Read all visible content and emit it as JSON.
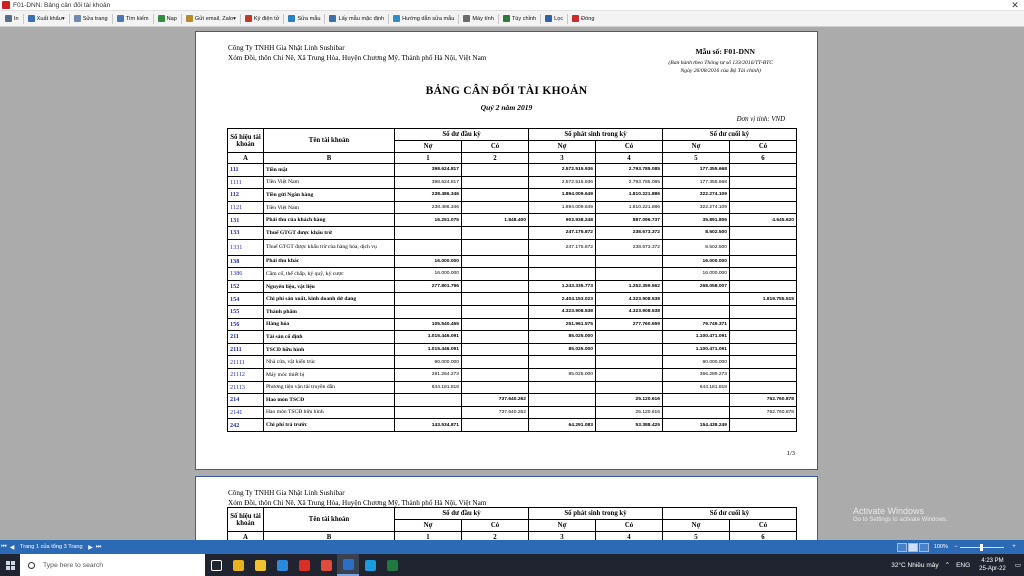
{
  "window": {
    "title": "F01-DNN: Bảng cân đối tài khoản",
    "close_glyph": "✕"
  },
  "toolbar": [
    {
      "name": "print",
      "label": "In",
      "color": "#5a6c8c"
    },
    {
      "name": "export",
      "label": "Xuất khẩu",
      "color": "#3a6fb3",
      "caret": true
    },
    {
      "name": "edit",
      "label": "Sửa trang",
      "color": "#6f8bb0"
    },
    {
      "name": "find",
      "label": "Tìm kiếm",
      "color": "#4a78b8"
    },
    {
      "name": "load",
      "label": "Nạp",
      "color": "#2f8f3c"
    },
    {
      "name": "email",
      "label": "Gửi email, Zalo",
      "color": "#b48a2a",
      "caret": true
    },
    {
      "name": "esign",
      "label": "Ký điện tử",
      "color": "#c0392b"
    },
    {
      "name": "edit-template",
      "label": "Sửa mẫu",
      "color": "#2a7fc4"
    },
    {
      "name": "default-template",
      "label": "Lấy mẫu mặc định",
      "color": "#3d6fa8"
    },
    {
      "name": "guide",
      "label": "Hướng dẫn sửa mẫu",
      "color": "#2b8fce"
    },
    {
      "name": "calculator",
      "label": "Máy tính",
      "color": "#6a6a6a"
    },
    {
      "name": "options",
      "label": "Tùy chỉnh",
      "color": "#2f7a3a"
    },
    {
      "name": "filter",
      "label": "Lọc",
      "color": "#2f62a8"
    },
    {
      "name": "close",
      "label": "Đóng",
      "color": "#cc2b2b"
    }
  ],
  "report": {
    "company_name": "Công Ty TNHH Gia Nhật Linh Sushibar",
    "company_address": "Xóm Đồi, thôn Chi Nê, Xã Trung Hòa, Huyện Chương Mỹ, Thành phố Hà Nội, Việt Nam",
    "form_no": "Mẫu số: F01-DNN",
    "form_note1": "(Ban hành theo Thông tư số 133/2016/TT-BTC",
    "form_note2": "Ngày 26/08/2016 của Bộ Tài chính)",
    "title": "BẢNG CÂN ĐỐI TÀI KHOẢN",
    "period": "Quý 2 năm 2019",
    "unit": "Đơn vị tính: VND",
    "page_number": "1/3",
    "headers": {
      "code": "Số hiệu tài khoản",
      "name": "Tên tài khoản",
      "opening": "Số dư đầu kỳ",
      "movement": "Số phát sinh trong kỳ",
      "closing": "Số dư cuối kỳ",
      "debit": "Nợ",
      "credit": "Có"
    },
    "index_row": [
      "A",
      "B",
      "1",
      "2",
      "3",
      "4",
      "5",
      "6"
    ],
    "rows": [
      {
        "code": "111",
        "name": "Tiền mặt",
        "bold": true,
        "v": [
          "398.624.817",
          "",
          "2.572.515.936",
          "2.793.785.085",
          "177.355.668",
          ""
        ]
      },
      {
        "code": "1111",
        "name": "Tiền Việt Nam",
        "v": [
          "398.624.817",
          "",
          "2.572.515.936",
          "2.793.785.085",
          "177.355.668",
          ""
        ]
      },
      {
        "code": "112",
        "name": "Tiền gửi Ngân hàng",
        "bold": true,
        "v": [
          "238.486.346",
          "",
          "1.894.009.649",
          "1.810.221.886",
          "322.274.109",
          ""
        ]
      },
      {
        "code": "1121",
        "name": "Tiền Việt Nam",
        "v": [
          "238.486.346",
          "",
          "1.894.009.649",
          "1.810.221.886",
          "322.274.109",
          ""
        ]
      },
      {
        "code": "131",
        "name": "Phải thu của khách hàng",
        "bold": true,
        "v": [
          "16.251.075",
          "1.848.400",
          "903.938.248",
          "887.096.737",
          "35.891.806",
          "4.645.620"
        ]
      },
      {
        "code": "133",
        "name": "Thuế GTGT được khấu trừ",
        "bold": true,
        "v": [
          "",
          "",
          "247.175.872",
          "238.673.372",
          "8.502.500",
          ""
        ]
      },
      {
        "code": "1331",
        "name": "Thuế GTGT được khấu trừ của hàng hóa, dịch vụ",
        "tall": true,
        "v": [
          "",
          "",
          "247.175.872",
          "238.673.372",
          "8.502.500",
          ""
        ]
      },
      {
        "code": "138",
        "name": "Phải thu khác",
        "bold": true,
        "v": [
          "16.000.000",
          "",
          "",
          "",
          "16.000.000",
          ""
        ]
      },
      {
        "code": "1386",
        "name": "Cầm cố, thế chấp, ký quỹ, ký cược",
        "v": [
          "16.000.000",
          "",
          "",
          "",
          "16.000.000",
          ""
        ]
      },
      {
        "code": "152",
        "name": "Nguyên liệu, vật liệu",
        "bold": true,
        "v": [
          "277.801.796",
          "",
          "1.243.335.773",
          "1.252.359.562",
          "268.058.007",
          ""
        ]
      },
      {
        "code": "154",
        "name": "Chi phí sản xuất, kinh doanh dở dang",
        "bold": true,
        "v": [
          "",
          "",
          "2.404.153.023",
          "4.323.908.538",
          "",
          "1.919.755.515"
        ]
      },
      {
        "code": "155",
        "name": "Thành phẩm",
        "bold": true,
        "v": [
          "",
          "",
          "4.323.908.538",
          "4.323.908.538",
          "",
          ""
        ]
      },
      {
        "code": "156",
        "name": "Hàng hóa",
        "bold": true,
        "v": [
          "105.540.455",
          "",
          "251.961.575",
          "277.760.659",
          "79.749.371",
          ""
        ]
      },
      {
        "code": "211",
        "name": "Tài sản cố định",
        "bold": true,
        "v": [
          "1.015.446.091",
          "",
          "85.025.000",
          "",
          "1.100.471.091",
          ""
        ]
      },
      {
        "code": "2111",
        "name": "TSCĐ hữu hình",
        "bold": true,
        "v": [
          "1.015.446.091",
          "",
          "85.025.000",
          "",
          "1.100.471.091",
          ""
        ]
      },
      {
        "code": "21111",
        "name": "Nhà cửa, vật kiến trúc",
        "v": [
          "90.000.000",
          "",
          "",
          "",
          "90.000.000",
          ""
        ]
      },
      {
        "code": "21112",
        "name": "Máy móc thiết bị",
        "v": [
          "281.264.273",
          "",
          "85.025.000",
          "",
          "366.289.273",
          ""
        ]
      },
      {
        "code": "21113",
        "name": "Phương tiện vận tải truyền dẫn",
        "v": [
          "644.181.818",
          "",
          "",
          "",
          "644.181.818",
          ""
        ]
      },
      {
        "code": "214",
        "name": "Hao mòn TSCĐ",
        "bold": true,
        "v": [
          "",
          "737.640.262",
          "",
          "25.120.616",
          "",
          "762.760.878"
        ]
      },
      {
        "code": "2141",
        "name": "Hao mòn TSCĐ hữu hình",
        "v": [
          "",
          "737.640.262",
          "",
          "25.120.616",
          "",
          "762.760.878"
        ]
      },
      {
        "code": "242",
        "name": "Chi phí trả trước",
        "bold": true,
        "v": [
          "143.534.871",
          "",
          "64.291.083",
          "53.388.425",
          "154.438.249",
          ""
        ]
      }
    ],
    "page2_index_row": [
      "A",
      "B",
      "1",
      "2",
      "3",
      "4",
      "5",
      "6"
    ]
  },
  "statusbar": {
    "pager": "Trang 1 của tổng 3 Trang",
    "first": "⏮",
    "prev": "◀",
    "next": "▶",
    "last": "⏭",
    "zoom": "100%",
    "zoom_level_percent": 100,
    "zoom_out": "−",
    "zoom_in": "+"
  },
  "watermark": {
    "line1": "Activate Windows",
    "line2": "Go to Settings to activate Windows."
  },
  "taskbar": {
    "search_placeholder": "Type here to search",
    "apps": [
      {
        "name": "task-view",
        "color": "#ffffff"
      },
      {
        "name": "chrome",
        "color": "#e8b21e"
      },
      {
        "name": "file-explorer",
        "color": "#f1c232"
      },
      {
        "name": "zalo",
        "color": "#2a8ae0"
      },
      {
        "name": "app-red",
        "color": "#d93025"
      },
      {
        "name": "chrome-2",
        "color": "#e04b3a"
      },
      {
        "name": "misa",
        "color": "#2b6fc4",
        "active": true
      },
      {
        "name": "app-blue",
        "color": "#1a9ae0"
      },
      {
        "name": "excel",
        "color": "#1f7a42"
      }
    ],
    "weather": "32°C  Nhiều mây",
    "lang": "ENG",
    "time": "4:23 PM",
    "date": "25-Apr-22"
  },
  "colors": {
    "link_code": "#1f2bb8",
    "status_bar": "#2d6ab6",
    "page_border": "#3b5ba7"
  }
}
